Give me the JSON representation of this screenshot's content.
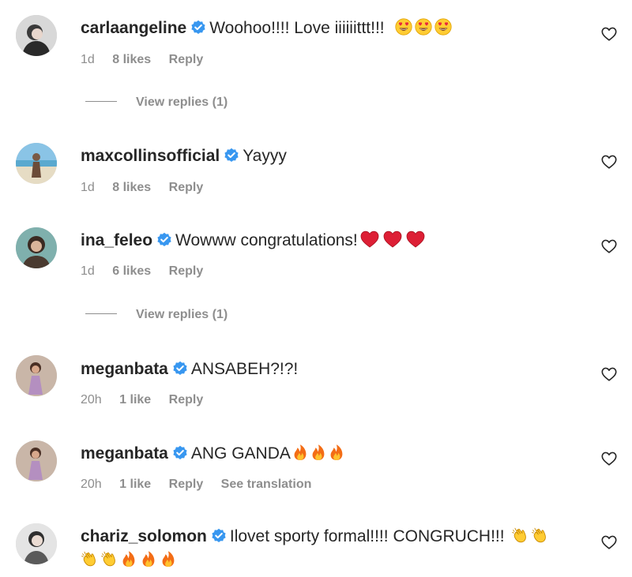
{
  "comments": [
    {
      "username": "carlaangeline",
      "text": "Woohoo!!!! Love iiiiiittt!!!",
      "emojis": [
        "heart-eyes-emoji",
        "heart-eyes-emoji",
        "heart-eyes-emoji"
      ],
      "time": "1d",
      "likes": "8 likes",
      "reply": "Reply",
      "view_replies": "View replies (1)"
    },
    {
      "username": "maxcollinsofficial",
      "text": "Yayyy",
      "emojis": [],
      "time": "1d",
      "likes": "8 likes",
      "reply": "Reply"
    },
    {
      "username": "ina_feleo",
      "text": "Wowww congratulations!",
      "emojis": [
        "red-heart-emoji",
        "red-heart-emoji",
        "red-heart-emoji"
      ],
      "time": "1d",
      "likes": "6 likes",
      "reply": "Reply",
      "view_replies": "View replies (1)"
    },
    {
      "username": "meganbata",
      "text": "ANSABEH?!?!",
      "emojis": [],
      "time": "20h",
      "likes": "1 like",
      "reply": "Reply"
    },
    {
      "username": "meganbata",
      "text": "ANG GANDA",
      "emojis": [
        "fire-emoji",
        "fire-emoji",
        "fire-emoji"
      ],
      "time": "20h",
      "likes": "1 like",
      "reply": "Reply",
      "see_translation": "See translation"
    },
    {
      "username": "chariz_solomon",
      "text": "Ilovet sporty formal!!!! CONGRUCH!!!",
      "emojis": [
        "clapping-emoji",
        "clapping-emoji"
      ],
      "emojis_line2": [
        "clapping-emoji",
        "clapping-emoji",
        "fire-emoji",
        "fire-emoji",
        "fire-emoji"
      ]
    }
  ],
  "icons": {
    "verified_badge": "verified-badge-icon",
    "like": "heart-outline-icon"
  },
  "colors": {
    "verified_blue": "#3897f0",
    "meta_gray": "#8e8e8e",
    "text": "#262626"
  }
}
